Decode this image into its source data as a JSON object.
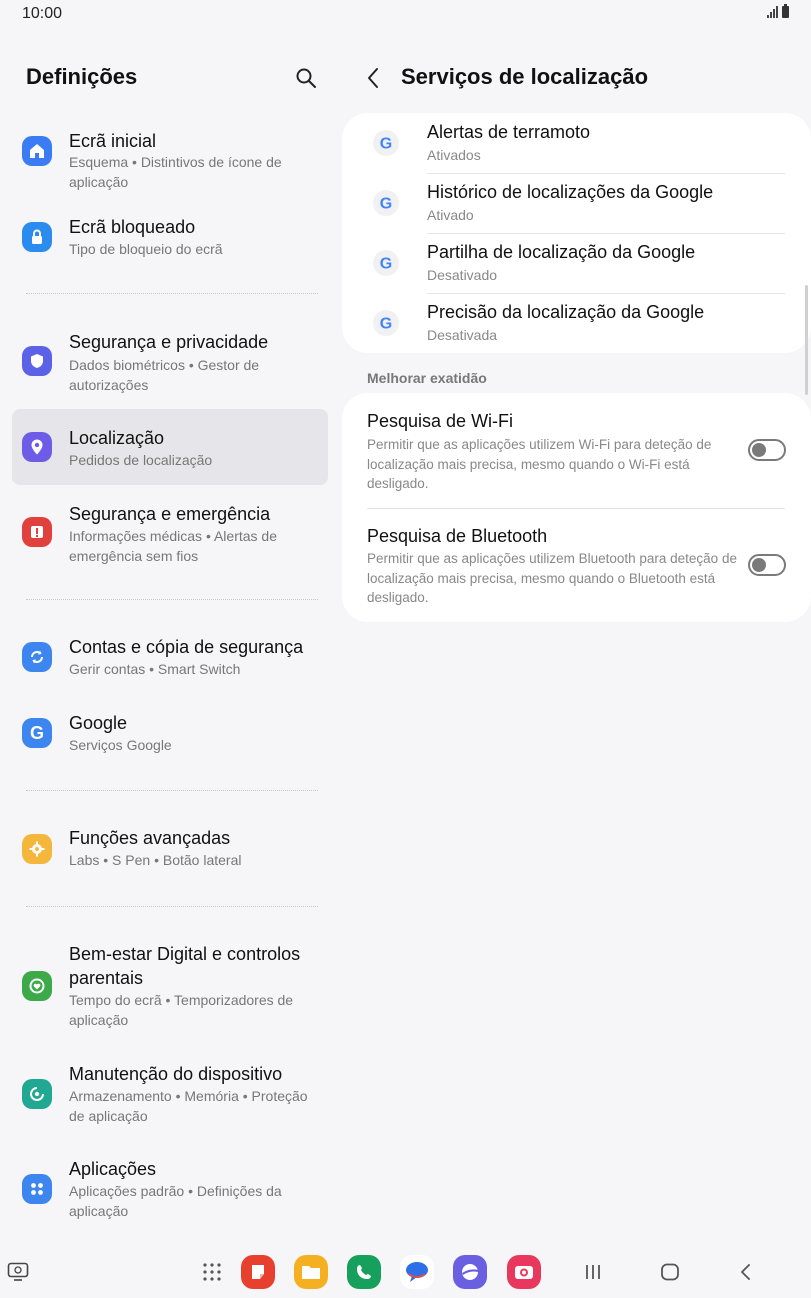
{
  "status": {
    "time": "10:00"
  },
  "left": {
    "title": "Definições",
    "items": [
      {
        "title": "Ecrã inicial",
        "subtitle": "Esquema  •  Distintivos de ícone de aplicação",
        "icon": "home-icon",
        "color": "#3b7cf5"
      },
      {
        "title": "Ecrã bloqueado",
        "subtitle": "Tipo de bloqueio do ecrã",
        "icon": "lock-icon",
        "color": "#2b8cf0"
      },
      {
        "title": "Segurança e privacidade",
        "subtitle": "Dados biométricos  •  Gestor de autorizações",
        "icon": "shield-icon",
        "color": "#5b62e8"
      },
      {
        "title": "Localização",
        "subtitle": "Pedidos de localização",
        "icon": "location-pin-icon",
        "color": "#6d5ce6"
      },
      {
        "title": "Segurança e emergência",
        "subtitle": "Informações médicas  •  Alertas de emergência sem fios",
        "icon": "emergency-icon",
        "color": "#e0413d"
      },
      {
        "title": "Contas e cópia de segurança",
        "subtitle": "Gerir contas  •  Smart Switch",
        "icon": "sync-icon",
        "color": "#3d86ef"
      },
      {
        "title": "Google",
        "subtitle": "Serviços Google",
        "icon": "google-icon",
        "color": "#3d86ef"
      },
      {
        "title": "Funções avançadas",
        "subtitle": "Labs  •  S Pen  •  Botão lateral",
        "icon": "gear-plus-icon",
        "color": "#f5b73b"
      },
      {
        "title": "Bem-estar Digital e controlos parentais",
        "subtitle": "Tempo do ecrã  •  Temporizadores de aplicação",
        "icon": "wellbeing-icon",
        "color": "#3daa4a"
      },
      {
        "title": "Manutenção do dispositivo",
        "subtitle": "Armazenamento  •  Memória  •  Proteção de aplicação",
        "icon": "device-care-icon",
        "color": "#21a892"
      },
      {
        "title": "Aplicações",
        "subtitle": "Aplicações padrão  •  Definições da aplicação",
        "icon": "apps-icon",
        "color": "#3d86ef"
      }
    ]
  },
  "right": {
    "title": "Serviços de localização",
    "google_items": [
      {
        "title": "Alertas de terramoto",
        "subtitle": "Ativados"
      },
      {
        "title": "Histórico de localizações da Google",
        "subtitle": "Ativado"
      },
      {
        "title": "Partilha de localização da Google",
        "subtitle": "Desativado"
      },
      {
        "title": "Precisão da localização da Google",
        "subtitle": "Desativada"
      }
    ],
    "section_label": "Melhorar exatidão",
    "toggles": [
      {
        "title": "Pesquisa de Wi-Fi",
        "description": "Permitir que as aplicações utilizem Wi-Fi para deteção de localização mais precisa, mesmo quando o Wi-Fi está desligado.",
        "on": false
      },
      {
        "title": "Pesquisa de Bluetooth",
        "description": "Permitir que as aplicações utilizem Bluetooth para deteção de localização mais precisa, mesmo quando o Bluetooth está desligado.",
        "on": false
      }
    ]
  },
  "dock": {
    "apps": [
      {
        "name": "notes-app-icon",
        "color": "#e8402f"
      },
      {
        "name": "my-files-app-icon",
        "color": "#f5b022"
      },
      {
        "name": "phone-app-icon",
        "color": "#17a05d"
      },
      {
        "name": "messages-app-icon",
        "color": "#ffffff"
      },
      {
        "name": "internet-app-icon",
        "color": "#6a5fe0"
      },
      {
        "name": "camera-app-icon",
        "color": "#e8385e"
      }
    ]
  }
}
